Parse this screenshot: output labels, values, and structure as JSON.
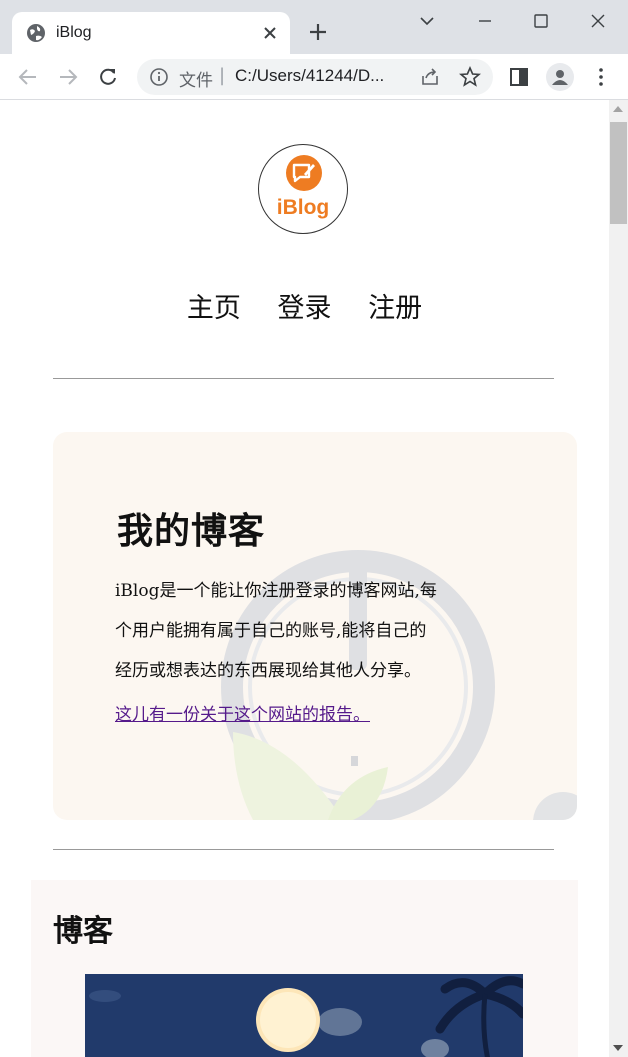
{
  "browser": {
    "tab_title": "iBlog",
    "address_scheme": "文件",
    "address_url": "C:/Users/41244/D..."
  },
  "site": {
    "logo_text": "iBlog",
    "nav": [
      "主页",
      "登录",
      "注册"
    ]
  },
  "hero": {
    "title": "我的博客",
    "description_lines": [
      "iBlog是一个能让你注册登录的博客网站,每",
      "个用户能拥有属于自己的账号,能将自己的",
      "经历或想表达的东西展现给其他人分享。"
    ],
    "report_link": "这儿有一份关于这个网站的报告。"
  },
  "blog": {
    "section_title": "博客"
  },
  "colors": {
    "brand_orange": "#ee7c22",
    "hero_bg": "#fcf7f1",
    "link_visited": "#551a8b",
    "blog_bg": "#fbf7f6"
  }
}
